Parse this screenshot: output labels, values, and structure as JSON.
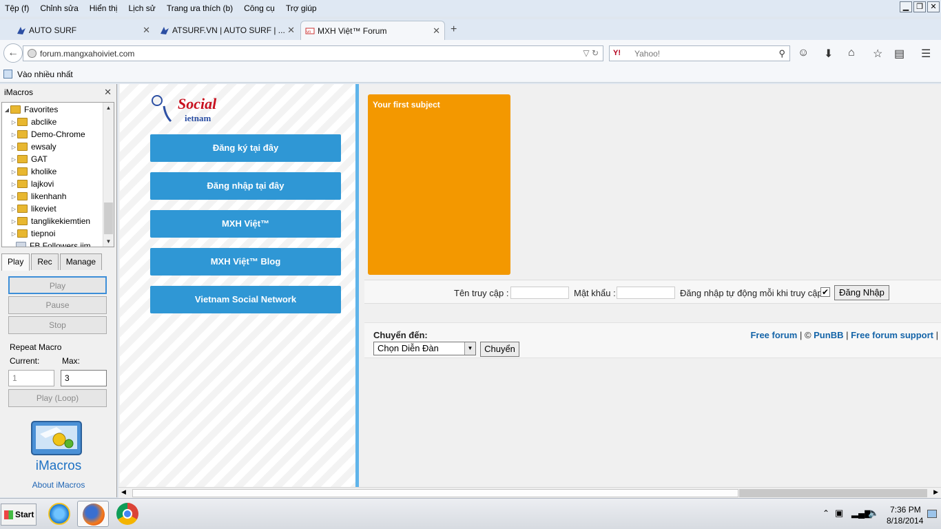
{
  "menu": [
    "Tệp (f)",
    "Chỉnh sửa",
    "Hiển thị",
    "Lịch sử",
    "Trang ưa thích (b)",
    "Công cụ",
    "Trợ giúp"
  ],
  "window_controls": {
    "minimize": "▁",
    "restore": "❐",
    "close": "✕"
  },
  "tabs": [
    {
      "title": "AUTO SURF",
      "icon": "autosurf-icon"
    },
    {
      "title": "ATSURF.VN | AUTO SURF | ...",
      "icon": "autosurf-icon"
    },
    {
      "title": "MXH Việt™ Forum",
      "icon": "mxh-icon"
    }
  ],
  "new_tab_symbol": "+",
  "address": {
    "url": "forum.mangxahoiviet.com",
    "controls": "▽ ↻"
  },
  "search": {
    "engine": "Y!",
    "placeholder": "Yahoo!",
    "magnifier": "⚲"
  },
  "bookmarks": {
    "most_visited": "Vào nhiều nhất"
  },
  "imacros": {
    "title": "iMacros",
    "close": "✕",
    "tree": {
      "root": "Favorites",
      "folders": [
        "abclike",
        "Demo-Chrome",
        "ewsaly",
        "GAT",
        "kholike",
        "lajkovi",
        "likenhanh",
        "likeviet",
        "tanglikekiemtien",
        "tiepnoi"
      ],
      "partial_item": "FB Followers.iim"
    },
    "tabs": [
      "Play",
      "Rec",
      "Manage"
    ],
    "buttons": {
      "play": "Play",
      "pause": "Pause",
      "stop": "Stop",
      "play_loop": "Play (Loop)"
    },
    "repeat_label": "Repeat Macro",
    "current_label": "Current:",
    "max_label": "Max:",
    "current_value": "1",
    "max_value": "3",
    "brand": "iMacros",
    "about": "About iMacros"
  },
  "forum": {
    "logo_text": "Social",
    "logo_sub": "ietnam",
    "side_buttons": [
      "Đăng ký tại đây",
      "Đăng nhập tại đây",
      "MXH Việt™",
      "MXH Việt™ Blog",
      "Vietnam Social Network"
    ],
    "subject_title": "Your first subject",
    "login": {
      "username_label": "Tên truy cập :",
      "password_label": "Mật khẩu :",
      "auto_login_label": "Đăng nhập tự động mỗi khi truy cập",
      "checkbox_mark": "✔",
      "submit": "Đăng Nhập"
    },
    "jump": {
      "label": "Chuyển đến:",
      "selected": "Chọn Diễn Đàn",
      "go": "Chuyển"
    },
    "footer": {
      "free_forum": "Free forum",
      "separator1": " | © ",
      "punbb": "PunBB",
      "separator2": " | ",
      "support": "Free forum support",
      "separator3": " |"
    }
  },
  "taskbar": {
    "start": "Start",
    "time": "7:36 PM",
    "date": "8/18/2014",
    "tray_arrow": "⌃"
  },
  "colors": {
    "accent_blue": "#2f97d5",
    "orange": "#f39800",
    "divider": "#5fb4ea"
  }
}
